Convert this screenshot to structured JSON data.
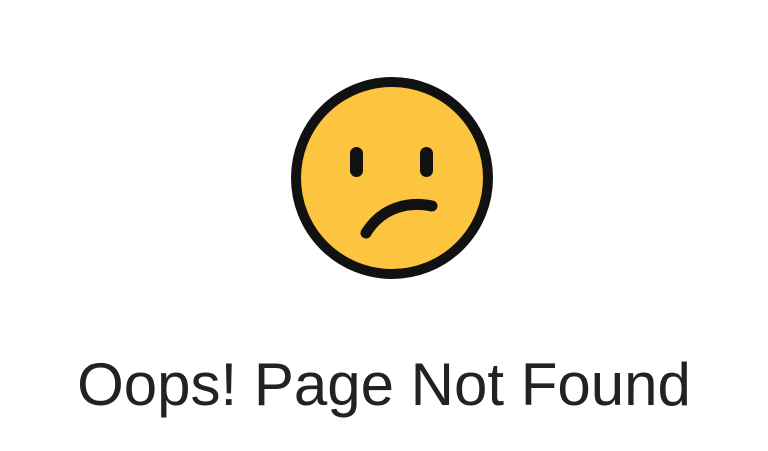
{
  "page": {
    "icon": "confused-face-icon",
    "message": "Oops! Page Not Found"
  },
  "colors": {
    "background": "#ffffff",
    "face_fill": "#FDC43F",
    "face_outline": "#111111",
    "text": "#222222"
  }
}
